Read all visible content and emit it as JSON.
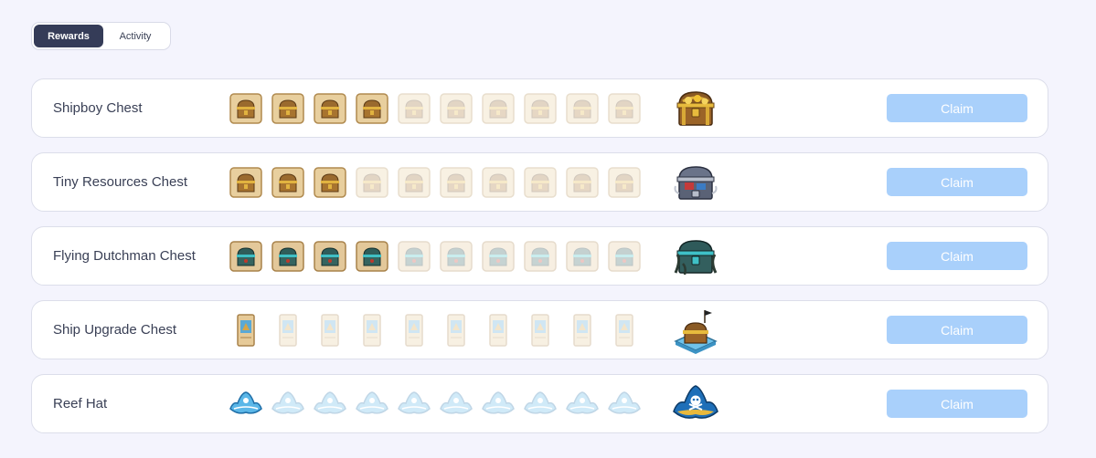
{
  "tabs": {
    "rewards": "Rewards",
    "activity": "Activity",
    "selected": "Rewards"
  },
  "rows": [
    {
      "title": "Shipboy Chest",
      "collected": 4,
      "total": 10,
      "token_icon": "map-chest-token-icon",
      "reward_icon": "golden-chest-icon",
      "claim": "Claim"
    },
    {
      "title": "Tiny Resources Chest",
      "collected": 3,
      "total": 10,
      "token_icon": "map-chest-token-icon",
      "reward_icon": "iron-chest-icon",
      "claim": "Claim"
    },
    {
      "title": "Flying Dutchman Chest",
      "collected": 4,
      "total": 10,
      "token_icon": "map-green-chest-token-icon",
      "reward_icon": "dutchman-chest-icon",
      "claim": "Claim"
    },
    {
      "title": "Ship Upgrade Chest",
      "collected": 1,
      "total": 10,
      "token_icon": "scroll-token-icon",
      "reward_icon": "ship-upgrade-chest-icon",
      "claim": "Claim"
    },
    {
      "title": "Reef Hat",
      "collected": 1,
      "total": 10,
      "token_icon": "blue-hat-token-icon",
      "reward_icon": "pirate-hat-icon",
      "claim": "Claim"
    }
  ],
  "colors": {
    "background": "#f4f4fd",
    "tab_active": "#353c58",
    "claim_button": "#a9d0fb"
  }
}
